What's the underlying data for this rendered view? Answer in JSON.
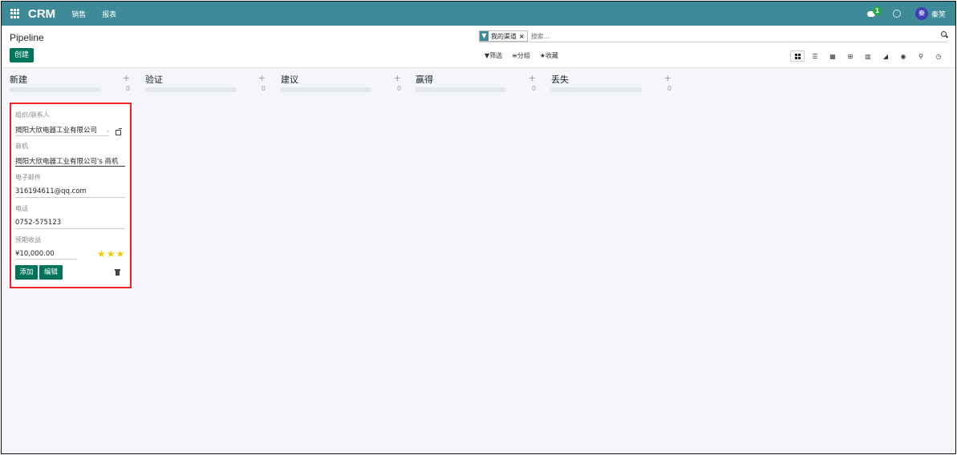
{
  "navbar": {
    "app_name": "CRM",
    "menus": [
      "销售",
      "报表"
    ],
    "notification_count": "1",
    "avatar_initial": "秦",
    "user_name": "秦笑"
  },
  "control": {
    "title": "Pipeline",
    "create_label": "创建",
    "facet_label": "我的渠道",
    "facet_close": "×",
    "search_placeholder": "搜索...",
    "filters_label": "筛选",
    "groupby_label": "分组",
    "favorites_label": "收藏"
  },
  "columns": [
    {
      "title": "新建",
      "count": "0"
    },
    {
      "title": "验证",
      "count": "0"
    },
    {
      "title": "建议",
      "count": "0"
    },
    {
      "title": "赢得",
      "count": "0"
    },
    {
      "title": "丢失",
      "count": "0"
    }
  ],
  "quick_create": {
    "contact_label": "组织/联系人",
    "contact_value": "揭阳大欣电器工业有限公司",
    "opportunity_label": "商机",
    "opportunity_value": "揭阳大欣电器工业有限公司's 商机",
    "email_label": "电子邮件",
    "email_value": "316194611@qq.com",
    "phone_label": "电话",
    "phone_value": "0752-575123",
    "revenue_label": "预期收益",
    "revenue_value": "¥10,000.00",
    "priority_stars": 3,
    "add_label": "添加",
    "edit_label": "编辑"
  },
  "colors": {
    "navbar": "#3e8a99",
    "primary": "#00745a",
    "star": "#f3cc00",
    "highlight_border": "#e22222"
  }
}
